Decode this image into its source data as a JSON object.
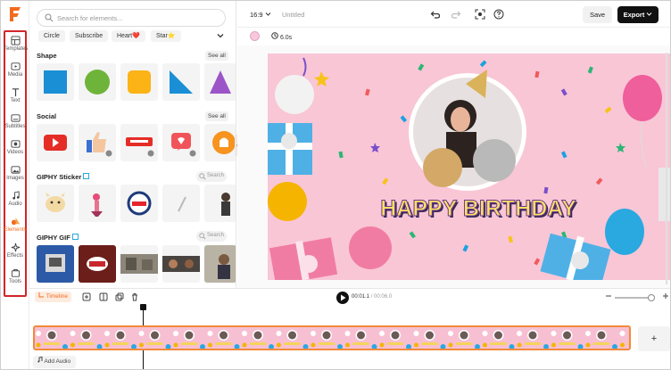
{
  "app": {
    "logo_letter": "F",
    "brand_color": "#f26b1d"
  },
  "rail": {
    "items": [
      {
        "label": "Templates",
        "icon": "template-icon"
      },
      {
        "label": "Media",
        "icon": "media-icon"
      },
      {
        "label": "Text",
        "icon": "text-icon"
      },
      {
        "label": "Subtitles",
        "icon": "subtitles-icon"
      },
      {
        "label": "Videos",
        "icon": "videos-icon"
      },
      {
        "label": "Images",
        "icon": "images-icon"
      },
      {
        "label": "Audio",
        "icon": "audio-icon"
      },
      {
        "label": "Elements",
        "icon": "elements-icon",
        "active": true
      },
      {
        "label": "Effects",
        "icon": "effects-icon"
      },
      {
        "label": "Tools",
        "icon": "tools-icon"
      }
    ]
  },
  "panel": {
    "search_placeholder": "Search for elements...",
    "chips": [
      "Circle",
      "Subscribe",
      "Heart❤️",
      "Star⭐"
    ],
    "sections": {
      "shape": {
        "title": "Shape",
        "see_all": "See all"
      },
      "social": {
        "title": "Social",
        "see_all": "See all"
      },
      "giphy_sticker": {
        "title": "GIPHY Sticker",
        "search": "Search"
      },
      "giphy_gif": {
        "title": "GIPHY GIF",
        "search": "Search"
      }
    }
  },
  "topbar": {
    "ratio": "16:9",
    "title": "Untitled",
    "save": "Save",
    "export": "Export"
  },
  "subbar": {
    "duration": "6.0s"
  },
  "canvas": {
    "headline": "HAPPY BIRTHDAY"
  },
  "timeline": {
    "label": "Timeline",
    "current_time": "00:01.1",
    "total_time": "/ 00:06.0",
    "add_audio": "Add Audio",
    "add_clip": "+"
  }
}
